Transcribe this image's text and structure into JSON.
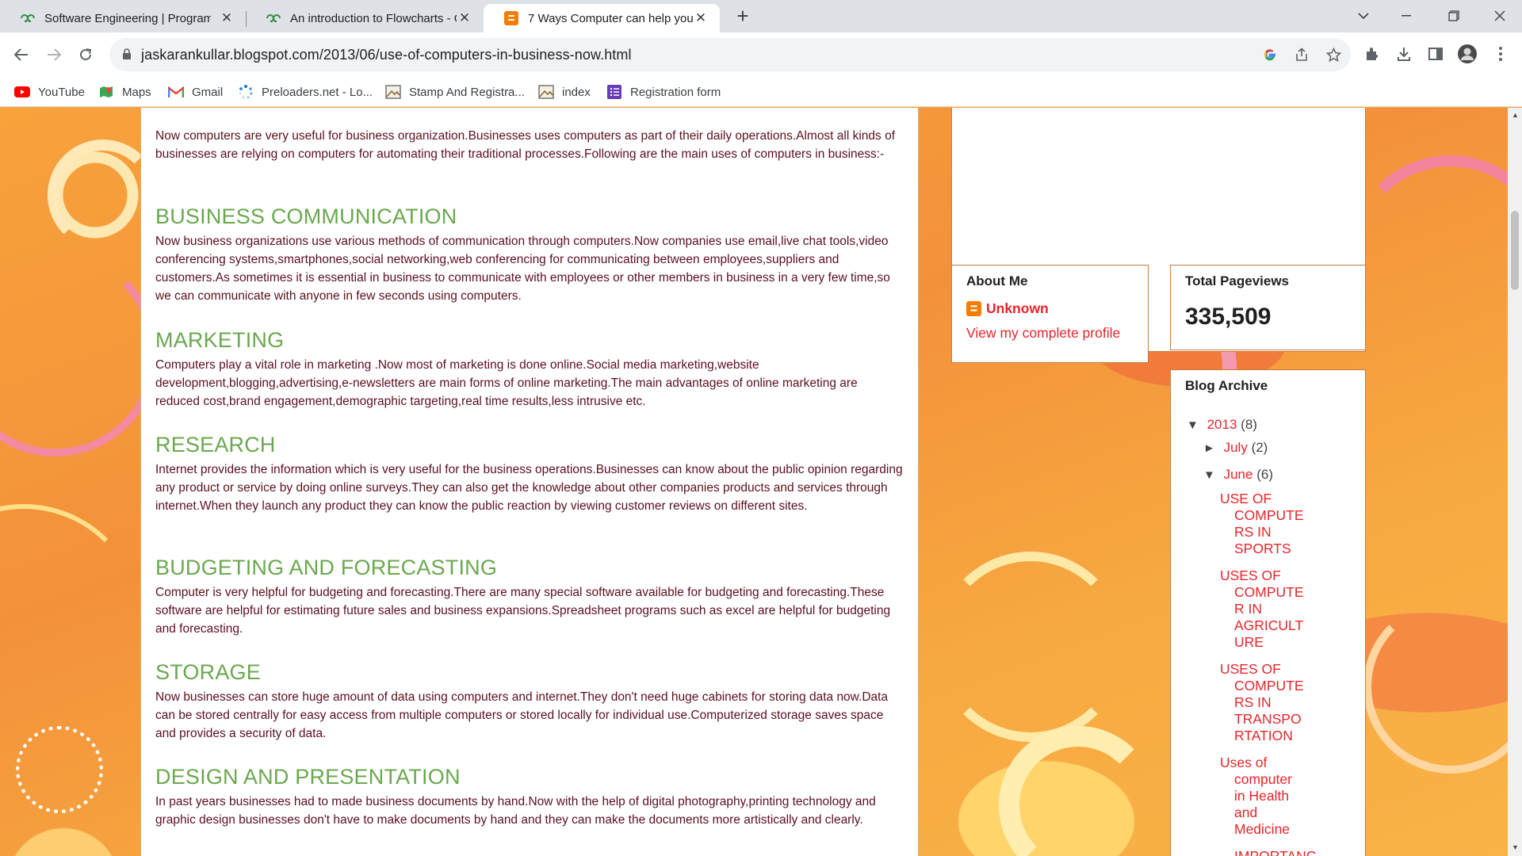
{
  "browser": {
    "tabs": [
      {
        "title": "Software Engineering | Program",
        "icon": "geeksforgeeks-icon",
        "active": false
      },
      {
        "title": "An introduction to Flowcharts - G",
        "icon": "geeksforgeeks-icon",
        "active": false
      },
      {
        "title": "7 Ways Computer can help you:",
        "icon": "blogger-icon",
        "active": true
      }
    ],
    "url": "jaskarankullar.blogspot.com/2013/06/use-of-computers-in-business-now.html",
    "bookmarks": [
      {
        "label": "YouTube",
        "icon": "youtube-icon"
      },
      {
        "label": "Maps",
        "icon": "maps-icon"
      },
      {
        "label": "Gmail",
        "icon": "gmail-icon"
      },
      {
        "label": "Preloaders.net - Lo...",
        "icon": "preloaders-icon"
      },
      {
        "label": "Stamp And Registra...",
        "icon": "image-icon"
      },
      {
        "label": "index",
        "icon": "image-icon"
      },
      {
        "label": "Registration form",
        "icon": "forms-icon"
      }
    ]
  },
  "article": {
    "intro": "Now computers are very useful for business organization.Businesses uses computers as part of their daily  operations.Almost all kinds of businesses are relying on computers for automating their traditional processes.Following are the main uses of computers in business:-",
    "sections": [
      {
        "heading": "BUSINESS COMMUNICATION",
        "text": "Now business organizations  use various methods of communication through computers.Now companies use email,live chat tools,video conferencing systems,smartphones,social networking,web conferencing for communicating between employees,suppliers and customers.As sometimes it is essential in business to communicate with employees or other members in business in a very few time,so we can communicate with anyone in few seconds using computers."
      },
      {
        "heading": "MARKETING",
        "text": "Computers play a vital role in marketing .Now most of marketing is done online.Social  media marketing,website development,blogging,advertising,e-newsletters are main forms of online marketing.The main advantages of online marketing are reduced cost,brand engagement,demographic targeting,real time results,less intrusive etc."
      },
      {
        "heading": "RESEARCH",
        "text": "Internet provides  the information which is very useful for the business operations.Businesses can know about the public opinion regarding any product or service by doing online surveys.They can also get the knowledge about other companies products and services through internet.When they launch any product they can know the public reaction by viewing customer reviews on different sites."
      },
      {
        "heading": "BUDGETING AND FORECASTING",
        "text": "Computer is very helpful for budgeting and forecasting.There are many special software available for budgeting and forecasting.These software are helpful for estimating future sales and business expansions.Spreadsheet programs such as excel are helpful for budgeting and forecasting."
      },
      {
        "heading": "STORAGE",
        "text": "Now businesses can store huge amount of data using computers and internet.They don't need huge cabinets for storing data now.Data can be stored centrally for easy access from multiple computers or stored locally for individual use.Computerized storage saves space and provides a security of data."
      },
      {
        "heading": "DESIGN AND PRESENTATION",
        "text": "In past years businesses had to made business documents by hand.Now with the help of digital photography,printing technology and graphic design businesses don't have to make documents by hand and they can make the documents more artistically and clearly."
      }
    ]
  },
  "sidebar": {
    "about": {
      "title": "About Me",
      "name": "Unknown",
      "link": "View my complete profile"
    },
    "pageviews": {
      "title": "Total Pageviews",
      "count": "335,509"
    },
    "archive": {
      "title": "Blog Archive",
      "year": {
        "label": "2013",
        "count": "(8)",
        "toggle": "▼"
      },
      "months": [
        {
          "label": "July",
          "count": "(2)",
          "toggle": "►"
        },
        {
          "label": "June",
          "count": "(6)",
          "toggle": "▼"
        }
      ],
      "posts": [
        [
          "USE OF",
          "COMPUTE",
          "RS IN",
          "SPORTS"
        ],
        [
          "USES OF",
          "COMPUTE",
          "R IN",
          "AGRICULT",
          "URE"
        ],
        [
          "USES OF",
          "COMPUTE",
          "RS IN",
          "TRANSPO",
          "RTATION"
        ],
        [
          "Uses of",
          "computer",
          "in Health",
          "and",
          "Medicine"
        ],
        [
          "IMPORTANC"
        ]
      ]
    }
  },
  "colors": {
    "heading": "#6aa84f",
    "body_text": "#5b0f1f",
    "link_red": "#e6252b",
    "profile_link": "#e6252b",
    "page_bg": "#f6a43b"
  }
}
